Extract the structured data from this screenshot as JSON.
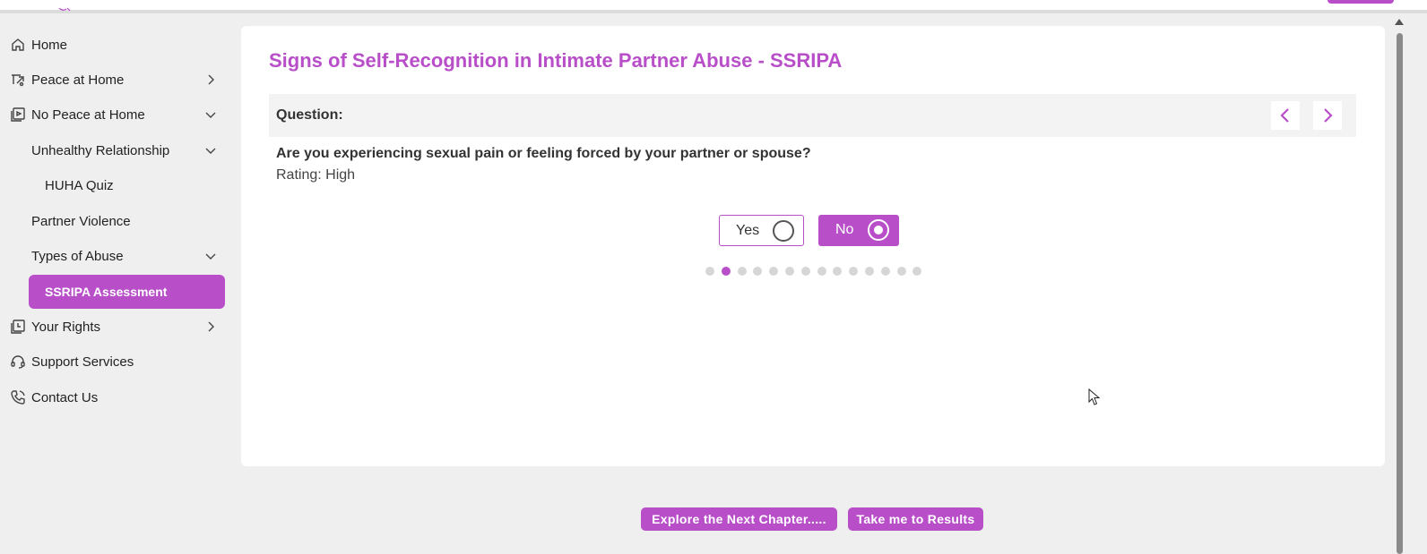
{
  "colors": {
    "accent": "#b84fc9",
    "page_bg": "#efefef",
    "card_bg": "#ffffff",
    "question_bar_bg": "#f3f3f3",
    "dot_inactive": "#d6d6d6"
  },
  "sidebar": {
    "items": [
      {
        "label": "Home",
        "icon": "home-icon",
        "chevron": "none"
      },
      {
        "label": "Peace at Home",
        "icon": "peace-icon",
        "chevron": "right"
      },
      {
        "label": "No Peace at Home",
        "icon": "video-icon",
        "chevron": "down"
      },
      {
        "label": "Unhealthy Relationship",
        "icon": "",
        "chevron": "down"
      },
      {
        "label": "HUHA Quiz",
        "icon": "",
        "chevron": "none"
      },
      {
        "label": "Partner Violence",
        "icon": "",
        "chevron": "none"
      },
      {
        "label": "Types of Abuse",
        "icon": "",
        "chevron": "down"
      },
      {
        "label": "SSRIPA Assessment",
        "icon": "",
        "chevron": "none",
        "active": true
      },
      {
        "label": "Your Rights",
        "icon": "book-icon",
        "chevron": "right"
      },
      {
        "label": "Support Services",
        "icon": "headset-icon",
        "chevron": "none"
      },
      {
        "label": "Contact Us",
        "icon": "phone-icon",
        "chevron": "none"
      }
    ]
  },
  "main": {
    "title": "Signs of Self-Recognition in Intimate Partner Abuse - SSRIPA",
    "question_label": "Question:",
    "question_text": "Are you experiencing sexual pain or feeling forced by your partner or spouse?",
    "rating": "Rating: High",
    "options": [
      {
        "label": "Yes",
        "selected": false
      },
      {
        "label": "No",
        "selected": true
      }
    ],
    "progress": {
      "total": 14,
      "current": 2
    }
  },
  "footer": {
    "next_chapter_label": "Explore the Next Chapter.....",
    "results_label": "Take me to Results"
  }
}
